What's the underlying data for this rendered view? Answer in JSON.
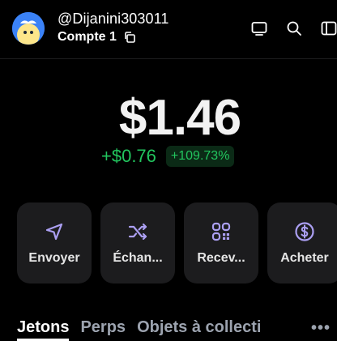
{
  "header": {
    "username": "@Dijanini303011",
    "account_name": "Compte 1",
    "icons": [
      "copy-icon",
      "monitor-icon",
      "search-icon",
      "sidebar-icon"
    ]
  },
  "balance": {
    "amount": "$1.46",
    "change_amount": "+$0.76",
    "change_percent": "+109.73%"
  },
  "actions": [
    {
      "label": "Envoyer",
      "icon": "send-icon"
    },
    {
      "label": "Échan...",
      "icon": "swap-icon"
    },
    {
      "label": "Recev...",
      "icon": "receive-icon"
    },
    {
      "label": "Acheter",
      "icon": "buy-icon"
    }
  ],
  "tabs": [
    {
      "label": "Jetons",
      "active": true
    },
    {
      "label": "Perps",
      "active": false
    },
    {
      "label": "Objets à collecti",
      "active": false
    }
  ],
  "colors": {
    "background": "#000000",
    "accent": "#ab9ff2",
    "positive": "#22c55e",
    "card": "#1c1c1e"
  }
}
